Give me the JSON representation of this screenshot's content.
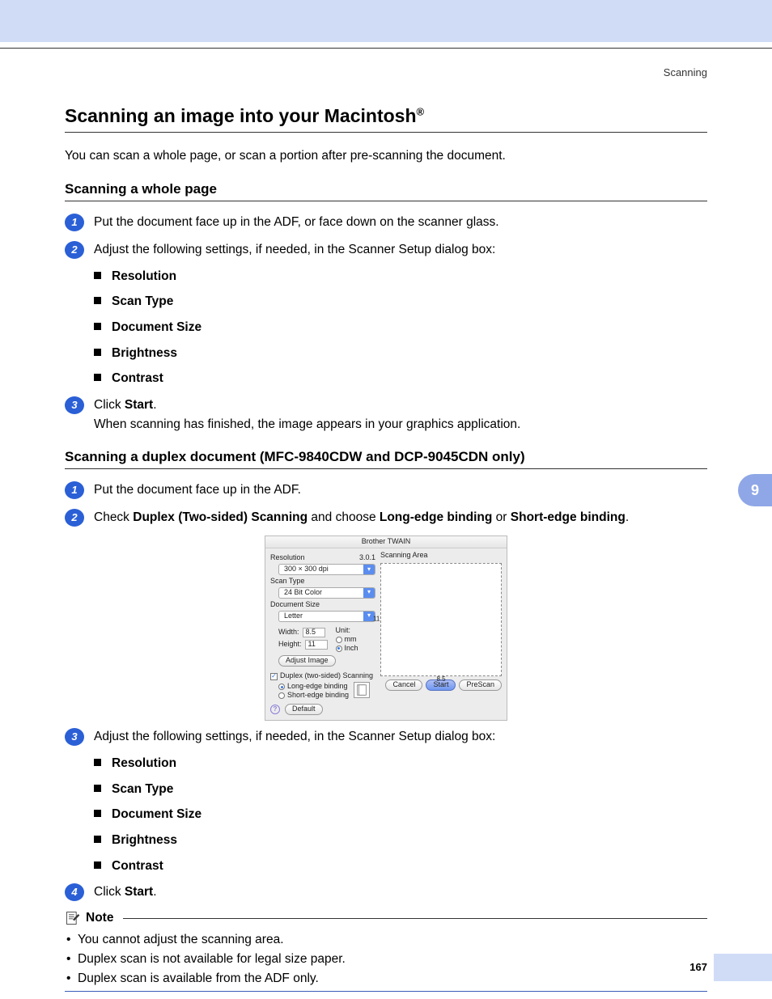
{
  "header_label": "Scanning",
  "page_title_main": "Scanning an image into your Macintosh",
  "page_title_sup": "®",
  "intro_text": "You can scan a whole page, or scan a portion after pre-scanning the document.",
  "section1": {
    "heading": "Scanning a whole page",
    "step1": "Put the document face up in the ADF, or face down on the scanner glass.",
    "step2": "Adjust the following settings, if needed, in the Scanner Setup dialog box:",
    "bullets": [
      "Resolution",
      "Scan Type",
      "Document Size",
      "Brightness",
      "Contrast"
    ],
    "step3_pre": "Click ",
    "step3_bold": "Start",
    "step3_post": ".",
    "step3_line2": "When scanning has finished, the image appears in your graphics application."
  },
  "section2": {
    "heading": "Scanning a duplex document (MFC-9840CDW and DCP-9045CDN only)",
    "step1": "Put the document face up in the ADF.",
    "step2_pre": "Check ",
    "step2_b1": "Duplex (Two-sided) Scanning",
    "step2_mid": " and choose ",
    "step2_b2": "Long-edge binding",
    "step2_or": " or ",
    "step2_b3": "Short-edge binding",
    "step2_post": ".",
    "step3": "Adjust the following settings, if needed, in the Scanner Setup dialog box:",
    "bullets": [
      "Resolution",
      "Scan Type",
      "Document Size",
      "Brightness",
      "Contrast"
    ],
    "step4_pre": "Click ",
    "step4_bold": "Start",
    "step4_post": "."
  },
  "dialog": {
    "title": "Brother TWAIN",
    "resolution_label": "Resolution",
    "version": "3.0.1",
    "resolution_value": "300 × 300 dpi",
    "scantype_label": "Scan Type",
    "scantype_value": "24 Bit Color",
    "docsize_label": "Document Size",
    "docsize_value": "Letter",
    "width_label": "Width:",
    "width_value": "8.5",
    "height_label": "Height:",
    "height_value": "11",
    "unit_label": "Unit:",
    "unit_mm": "mm",
    "unit_inch": "Inch",
    "adjust_image": "Adjust Image",
    "duplex_label": "Duplex (two-sided) Scanning",
    "long_edge": "Long-edge binding",
    "short_edge": "Short-edge binding",
    "default_btn": "Default",
    "scanning_area_label": "Scanning Area",
    "tick_v": "11",
    "tick_h": "8.5",
    "cancel_btn": "Cancel",
    "start_btn": "Start",
    "prescan_btn": "PreScan"
  },
  "note": {
    "heading": "Note",
    "items": [
      "You cannot adjust the scanning area.",
      "Duplex scan is not available for legal size paper.",
      "Duplex scan is available from the ADF only."
    ]
  },
  "chapter_number": "9",
  "page_number": "167"
}
